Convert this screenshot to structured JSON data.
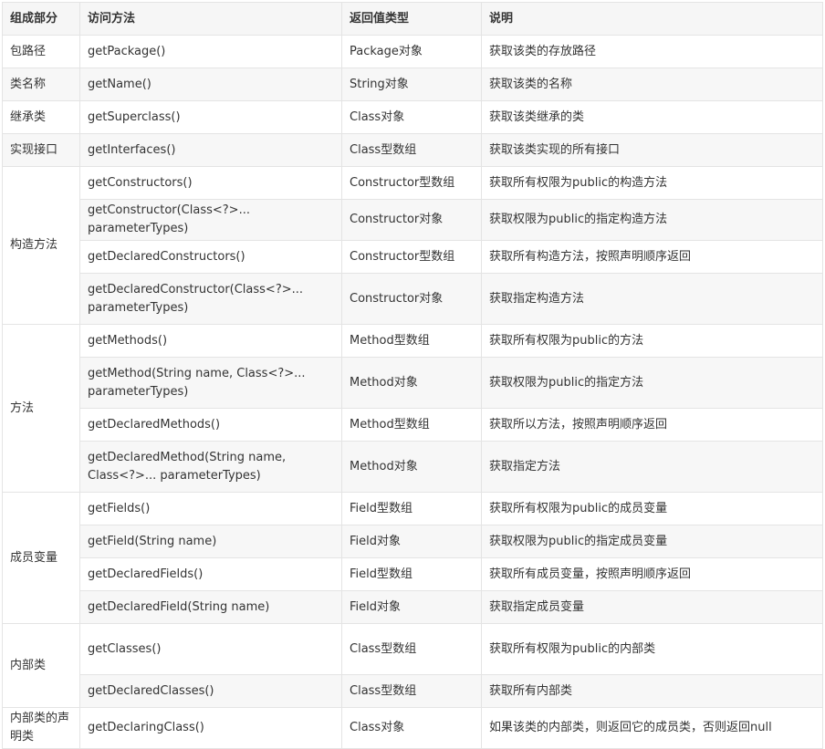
{
  "header": [
    "组成部分",
    "访问方法",
    "返回值类型",
    "说明"
  ],
  "groups": [
    {
      "label": "包路径",
      "rows": [
        [
          "getPackage()",
          "Package对象",
          "获取该类的存放路径"
        ]
      ]
    },
    {
      "label": "类名称",
      "rows": [
        [
          "getName()",
          "String对象",
          "获取该类的名称"
        ]
      ]
    },
    {
      "label": "继承类",
      "rows": [
        [
          "getSuperclass()",
          "Class对象",
          "获取该类继承的类"
        ]
      ]
    },
    {
      "label": "实现接口",
      "rows": [
        [
          "getInterfaces()",
          "Class型数组",
          "获取该类实现的所有接口"
        ]
      ]
    },
    {
      "label": "构造方法",
      "rows": [
        [
          "getConstructors()",
          "Constructor型数组",
          "获取所有权限为public的构造方法"
        ],
        [
          "getConstructor(Class<?>... parameterTypes)",
          "Constructor对象",
          "获取权限为public的指定构造方法"
        ],
        [
          "getDeclaredConstructors()",
          "Constructor型数组",
          "获取所有构造方法，按照声明顺序返回"
        ],
        [
          "getDeclaredConstructor(Class<?>... parameterTypes)",
          "Constructor对象",
          "获取指定构造方法"
        ]
      ]
    },
    {
      "label": "方法",
      "rows": [
        [
          "getMethods()",
          "Method型数组",
          "获取所有权限为public的方法"
        ],
        [
          "getMethod(String name, Class<?>... parameterTypes)",
          "Method对象",
          "获取权限为public的指定方法"
        ],
        [
          "getDeclaredMethods()",
          "Method型数组",
          "获取所以方法，按照声明顺序返回"
        ],
        [
          "getDeclaredMethod(String name, Class<?>... parameterTypes)",
          "Method对象",
          "获取指定方法"
        ]
      ]
    },
    {
      "label": "成员变量",
      "rows": [
        [
          "getFields()",
          "Field型数组",
          "获取所有权限为public的成员变量"
        ],
        [
          "getField(String name)",
          "Field对象",
          "获取权限为public的指定成员变量"
        ],
        [
          "getDeclaredFields()",
          "Field型数组",
          "获取所有成员变量，按照声明顺序返回"
        ],
        [
          "getDeclaredField(String name)",
          "Field对象",
          "获取指定成员变量"
        ]
      ]
    },
    {
      "label": "内部类",
      "rows": [
        [
          "getClasses()",
          "Class型数组",
          "获取所有权限为public的内部类"
        ],
        [
          "getDeclaredClasses()",
          "Class型数组",
          "获取所有内部类"
        ]
      ]
    },
    {
      "label": "内部类的声明类",
      "rows": [
        [
          "getDeclaringClass()",
          "Class对象",
          "如果该类的内部类，则返回它的成员类，否则返回null"
        ]
      ]
    }
  ]
}
